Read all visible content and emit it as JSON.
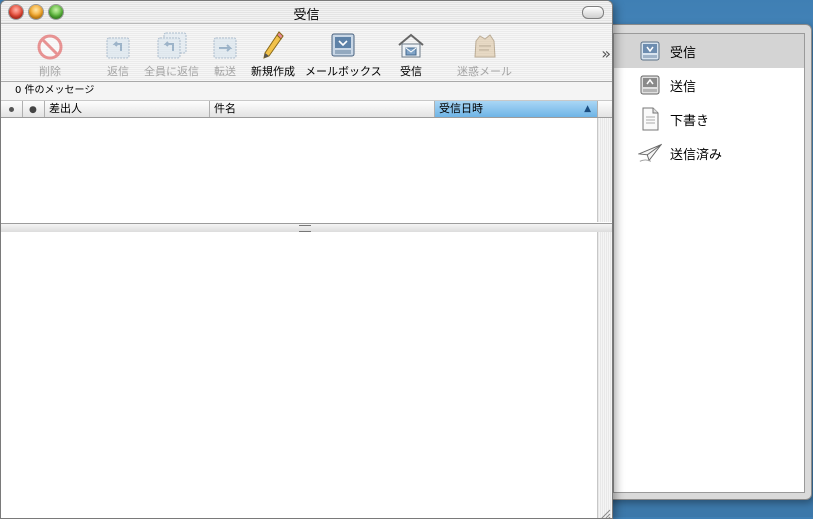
{
  "window": {
    "title": "受信"
  },
  "toolbar": {
    "items": [
      {
        "label": "削除",
        "icon": "delete-icon",
        "enabled": false
      },
      {
        "label": "返信",
        "icon": "reply-icon",
        "enabled": false
      },
      {
        "label": "全員に返信",
        "icon": "reply-all-icon",
        "enabled": false
      },
      {
        "label": "転送",
        "icon": "forward-icon",
        "enabled": false
      },
      {
        "label": "新規作成",
        "icon": "compose-pencil-icon",
        "enabled": true
      },
      {
        "label": "メールボックス",
        "icon": "mailbox-tray-icon",
        "enabled": true
      },
      {
        "label": "受信",
        "icon": "get-mail-house-icon",
        "enabled": true
      },
      {
        "label": "迷惑メール",
        "icon": "junk-mail-icon",
        "enabled": false
      }
    ],
    "overflow": "»"
  },
  "status": {
    "message_count": "0 件のメッセージ"
  },
  "columns": [
    {
      "label": ""
    },
    {
      "label": ""
    },
    {
      "label": "差出人"
    },
    {
      "label": "件名"
    },
    {
      "label": "受信日時",
      "sorted": true,
      "sort_indicator": "▲"
    }
  ],
  "messages": [],
  "mailboxes": [
    {
      "label": "受信",
      "icon": "inbox-tray-icon",
      "selected": true
    },
    {
      "label": "送信",
      "icon": "outbox-tray-icon",
      "selected": false
    },
    {
      "label": "下書き",
      "icon": "drafts-document-icon",
      "selected": false
    },
    {
      "label": "送信済み",
      "icon": "sent-paper-plane-icon",
      "selected": false
    }
  ],
  "colors": {
    "desktop": "#4f8cbe",
    "sort_header_highlight": "#8cc7ef",
    "disabled_label": "#a4a4a4"
  }
}
